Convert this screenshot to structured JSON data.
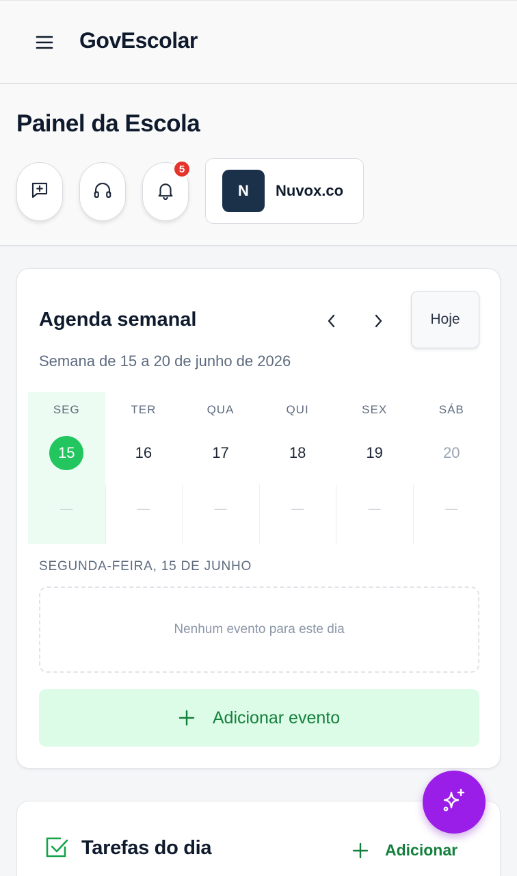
{
  "topbar": {
    "brand": "GovEscolar",
    "menu_icon": "hamburger-menu-icon"
  },
  "header": {
    "title": "Painel da Escola",
    "actions": [
      {
        "icon": "message-plus-icon"
      },
      {
        "icon": "headset-icon"
      },
      {
        "icon": "bell-icon",
        "badge": "5"
      }
    ],
    "account": {
      "initial": "N",
      "name": "Nuvox.co"
    }
  },
  "agenda": {
    "title": "Agenda semanal",
    "prev_icon": "chevron-left-icon",
    "next_icon": "chevron-right-icon",
    "today_label": "Hoje",
    "week_range": "Semana de 15 a 20 de junho de 2026",
    "days": [
      {
        "name": "SEG",
        "number": "15",
        "empty": "—",
        "selected": true
      },
      {
        "name": "TER",
        "number": "16",
        "empty": "—"
      },
      {
        "name": "QUA",
        "number": "17",
        "empty": "—"
      },
      {
        "name": "QUI",
        "number": "18",
        "empty": "—"
      },
      {
        "name": "SEX",
        "number": "19",
        "empty": "—"
      },
      {
        "name": "SÁB",
        "number": "20",
        "empty": "—",
        "muted": true
      }
    ],
    "selected_day_label": "SEGUNDA-FEIRA, 15 DE JUNHO",
    "empty_message": "Nenhum evento para este dia",
    "add_event_label": "Adicionar evento"
  },
  "tasks": {
    "title": "Tarefas do dia",
    "add_label": "Adicionar",
    "icon": "checkbox-checked-icon"
  },
  "fab": {
    "icon": "sparkles-icon"
  },
  "colors": {
    "primary_green": "#22c55e",
    "green_text": "#15803d",
    "fab_purple": "#9b1de8",
    "badge_red": "#e5342b",
    "navy": "#1b3049"
  }
}
